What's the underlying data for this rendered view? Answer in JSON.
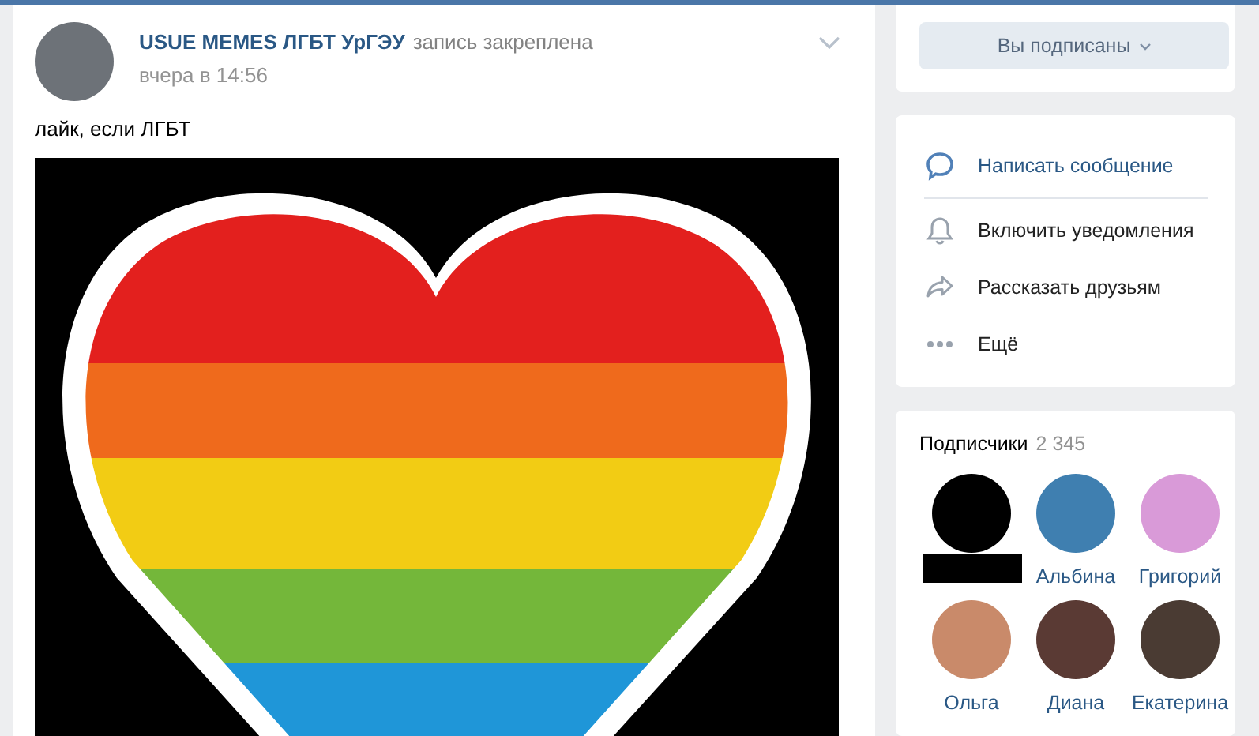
{
  "post": {
    "author": "USUE MEMES ЛГБТ УрГЭУ",
    "note": "запись закреплена",
    "time": "вчера в 14:56",
    "text": "лайк, если ЛГБТ"
  },
  "subscribe_button": {
    "label": "Вы подписаны"
  },
  "actions": [
    {
      "kind": "message",
      "label": "Написать сообщение"
    },
    {
      "kind": "notify",
      "label": "Включить уведомления"
    },
    {
      "kind": "share",
      "label": "Рассказать друзьям"
    },
    {
      "kind": "more",
      "label": "Ещё"
    }
  ],
  "subscribers": {
    "title": "Подписчики",
    "count": "2 345",
    "items": [
      {
        "redacted": true
      },
      {
        "redacted": false,
        "name": "Альбина"
      },
      {
        "redacted": false,
        "name": "Григорий"
      },
      {
        "redacted": false,
        "name": "Ольга"
      },
      {
        "redacted": false,
        "name": "Диана"
      },
      {
        "redacted": false,
        "name": "Екатерина"
      }
    ]
  }
}
